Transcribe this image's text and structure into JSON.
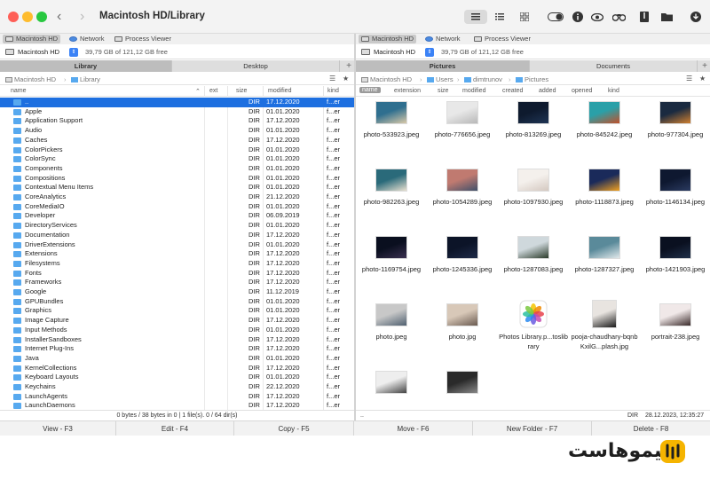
{
  "window": {
    "title": "Macintosh HD/Library"
  },
  "toolbar": {
    "icons": [
      "list-view-icon",
      "detail-view-icon",
      "grid-view-icon",
      "toggle-icon",
      "info-icon",
      "eye-icon",
      "binoculars-icon",
      "archive-icon",
      "folder-icon",
      "download-icon"
    ]
  },
  "left": {
    "devices": [
      {
        "label": "Macintosh HD",
        "selected": true
      },
      {
        "label": "Network"
      },
      {
        "label": "Process Viewer"
      }
    ],
    "volume": "Macintosh HD",
    "space": "39,79 GB of 121,12 GB free",
    "tabs": [
      {
        "label": "Library",
        "active": true
      },
      {
        "label": "Desktop"
      }
    ],
    "path": [
      "Macintosh HD",
      "Library"
    ],
    "columns": {
      "name": "name",
      "ext": "ext",
      "size": "size",
      "modified": "modified",
      "kind": "kind"
    },
    "files": [
      {
        "name": "..",
        "size": "DIR",
        "date": "17.12.2020",
        "kind": "f...er"
      },
      {
        "name": "Apple",
        "size": "DIR",
        "date": "01.01.2020",
        "kind": "f...er"
      },
      {
        "name": "Application Support",
        "size": "DIR",
        "date": "17.12.2020",
        "kind": "f...er"
      },
      {
        "name": "Audio",
        "size": "DIR",
        "date": "01.01.2020",
        "kind": "f...er"
      },
      {
        "name": "Caches",
        "size": "DIR",
        "date": "17.12.2020",
        "kind": "f...er"
      },
      {
        "name": "ColorPickers",
        "size": "DIR",
        "date": "01.01.2020",
        "kind": "f...er"
      },
      {
        "name": "ColorSync",
        "size": "DIR",
        "date": "01.01.2020",
        "kind": "f...er"
      },
      {
        "name": "Components",
        "size": "DIR",
        "date": "01.01.2020",
        "kind": "f...er"
      },
      {
        "name": "Compositions",
        "size": "DIR",
        "date": "01.01.2020",
        "kind": "f...er"
      },
      {
        "name": "Contextual Menu Items",
        "size": "DIR",
        "date": "01.01.2020",
        "kind": "f...er"
      },
      {
        "name": "CoreAnalytics",
        "size": "DIR",
        "date": "21.12.2020",
        "kind": "f...er"
      },
      {
        "name": "CoreMediaIO",
        "size": "DIR",
        "date": "01.01.2020",
        "kind": "f...er"
      },
      {
        "name": "Developer",
        "size": "DIR",
        "date": "06.09.2019",
        "kind": "f...er"
      },
      {
        "name": "DirectoryServices",
        "size": "DIR",
        "date": "01.01.2020",
        "kind": "f...er"
      },
      {
        "name": "Documentation",
        "size": "DIR",
        "date": "17.12.2020",
        "kind": "f...er"
      },
      {
        "name": "DriverExtensions",
        "size": "DIR",
        "date": "01.01.2020",
        "kind": "f...er"
      },
      {
        "name": "Extensions",
        "size": "DIR",
        "date": "17.12.2020",
        "kind": "f...er"
      },
      {
        "name": "Filesystems",
        "size": "DIR",
        "date": "17.12.2020",
        "kind": "f...er"
      },
      {
        "name": "Fonts",
        "size": "DIR",
        "date": "17.12.2020",
        "kind": "f...er"
      },
      {
        "name": "Frameworks",
        "size": "DIR",
        "date": "17.12.2020",
        "kind": "f...er"
      },
      {
        "name": "Google",
        "size": "DIR",
        "date": "11.12.2019",
        "kind": "f...er"
      },
      {
        "name": "GPUBundles",
        "size": "DIR",
        "date": "01.01.2020",
        "kind": "f...er"
      },
      {
        "name": "Graphics",
        "size": "DIR",
        "date": "01.01.2020",
        "kind": "f...er"
      },
      {
        "name": "Image Capture",
        "size": "DIR",
        "date": "17.12.2020",
        "kind": "f...er"
      },
      {
        "name": "Input Methods",
        "size": "DIR",
        "date": "01.01.2020",
        "kind": "f...er"
      },
      {
        "name": "InstallerSandboxes",
        "size": "DIR",
        "date": "17.12.2020",
        "kind": "f...er"
      },
      {
        "name": "Internet Plug-Ins",
        "size": "DIR",
        "date": "17.12.2020",
        "kind": "f...er"
      },
      {
        "name": "Java",
        "size": "DIR",
        "date": "01.01.2020",
        "kind": "f...er"
      },
      {
        "name": "KernelCollections",
        "size": "DIR",
        "date": "17.12.2020",
        "kind": "f...er"
      },
      {
        "name": "Keyboard Layouts",
        "size": "DIR",
        "date": "01.01.2020",
        "kind": "f...er"
      },
      {
        "name": "Keychains",
        "size": "DIR",
        "date": "22.12.2020",
        "kind": "f...er"
      },
      {
        "name": "LaunchAgents",
        "size": "DIR",
        "date": "17.12.2020",
        "kind": "f...er"
      },
      {
        "name": "LaunchDaemons",
        "size": "DIR",
        "date": "17.12.2020",
        "kind": "f...er"
      }
    ],
    "status": "0 bytes / 38 bytes in 0 | 1 file(s). 0 / 64 dir(s)"
  },
  "right": {
    "devices": [
      {
        "label": "Macintosh HD",
        "selected": true
      },
      {
        "label": "Network"
      },
      {
        "label": "Process Viewer"
      }
    ],
    "volume": "Macintosh HD",
    "space": "39,79 GB of 121,12 GB free",
    "tabs": [
      {
        "label": "Pictures",
        "active": true
      },
      {
        "label": "Documents"
      }
    ],
    "path": [
      "Macintosh HD",
      "Users",
      "dimtrunov",
      "Pictures"
    ],
    "columns": [
      "name",
      "extension",
      "size",
      "modified",
      "created",
      "added",
      "opened",
      "kind"
    ],
    "items": [
      {
        "name": "photo-533923.jpeg",
        "c1": "#2f6f8f",
        "c2": "#d9c9a8"
      },
      {
        "name": "photo-776656.jpeg",
        "c1": "#e8e8e8",
        "c2": "#b8b8b8"
      },
      {
        "name": "photo-813269.jpeg",
        "c1": "#0e1a2e",
        "c2": "#1f3555"
      },
      {
        "name": "photo-845242.jpeg",
        "c1": "#2aa0a8",
        "c2": "#c0502a"
      },
      {
        "name": "photo-977304.jpeg",
        "c1": "#1a2a40",
        "c2": "#d08030"
      },
      {
        "name": "photo-982263.jpeg",
        "c1": "#2a6a7a",
        "c2": "#e8e0d0"
      },
      {
        "name": "photo-1054289.jpeg",
        "c1": "#c07a70",
        "c2": "#40506a"
      },
      {
        "name": "photo-1097930.jpeg",
        "c1": "#f4f0ec",
        "c2": "#d4c8c0"
      },
      {
        "name": "photo-1118873.jpeg",
        "c1": "#1a2a5a",
        "c2": "#f0a020"
      },
      {
        "name": "photo-1146134.jpeg",
        "c1": "#0e1830",
        "c2": "#2a3a60"
      },
      {
        "name": "photo-1169754.jpeg",
        "c1": "#0a0f1f",
        "c2": "#3a3050"
      },
      {
        "name": "photo-1245336.jpeg",
        "c1": "#0c1428",
        "c2": "#1e2a48"
      },
      {
        "name": "photo-1287083.jpeg",
        "c1": "#cfd8dc",
        "c2": "#2a3a2a"
      },
      {
        "name": "photo-1287327.jpeg",
        "c1": "#5a8a9a",
        "c2": "#e0e8ea"
      },
      {
        "name": "photo-1421903.jpeg",
        "c1": "#0a1020",
        "c2": "#20304a"
      },
      {
        "name": "photo.jpeg",
        "c1": "#c8c8c8",
        "c2": "#506070"
      },
      {
        "name": "photo.jpg",
        "c1": "#d8c8b8",
        "c2": "#6a5a50"
      },
      {
        "name": "Photos Library.p...toslibrary",
        "c1": "#ffffff",
        "c2": "#f0f0f0",
        "app": true
      },
      {
        "name": "pooja-chaudhary-bqnbKxilG...plash.jpg",
        "c1": "#e8e4e0",
        "c2": "#1a1a1a"
      },
      {
        "name": "portrait-238.jpeg",
        "c1": "#f0e8e8",
        "c2": "#3a2a2a"
      },
      {
        "name": "",
        "c1": "#eeeeee",
        "c2": "#444444"
      },
      {
        "name": "",
        "c1": "#2a2a2a",
        "c2": "#888888"
      }
    ],
    "status_left": "..",
    "status_dir": "DIR",
    "status_date": "28.12.2023, 12:35:27"
  },
  "fkeys": [
    "View - F3",
    "Edit - F4",
    "Copy - F5",
    "Move - F6",
    "New Folder - F7",
    "Delete - F8"
  ],
  "logo": {
    "text": "لیموهاست"
  }
}
